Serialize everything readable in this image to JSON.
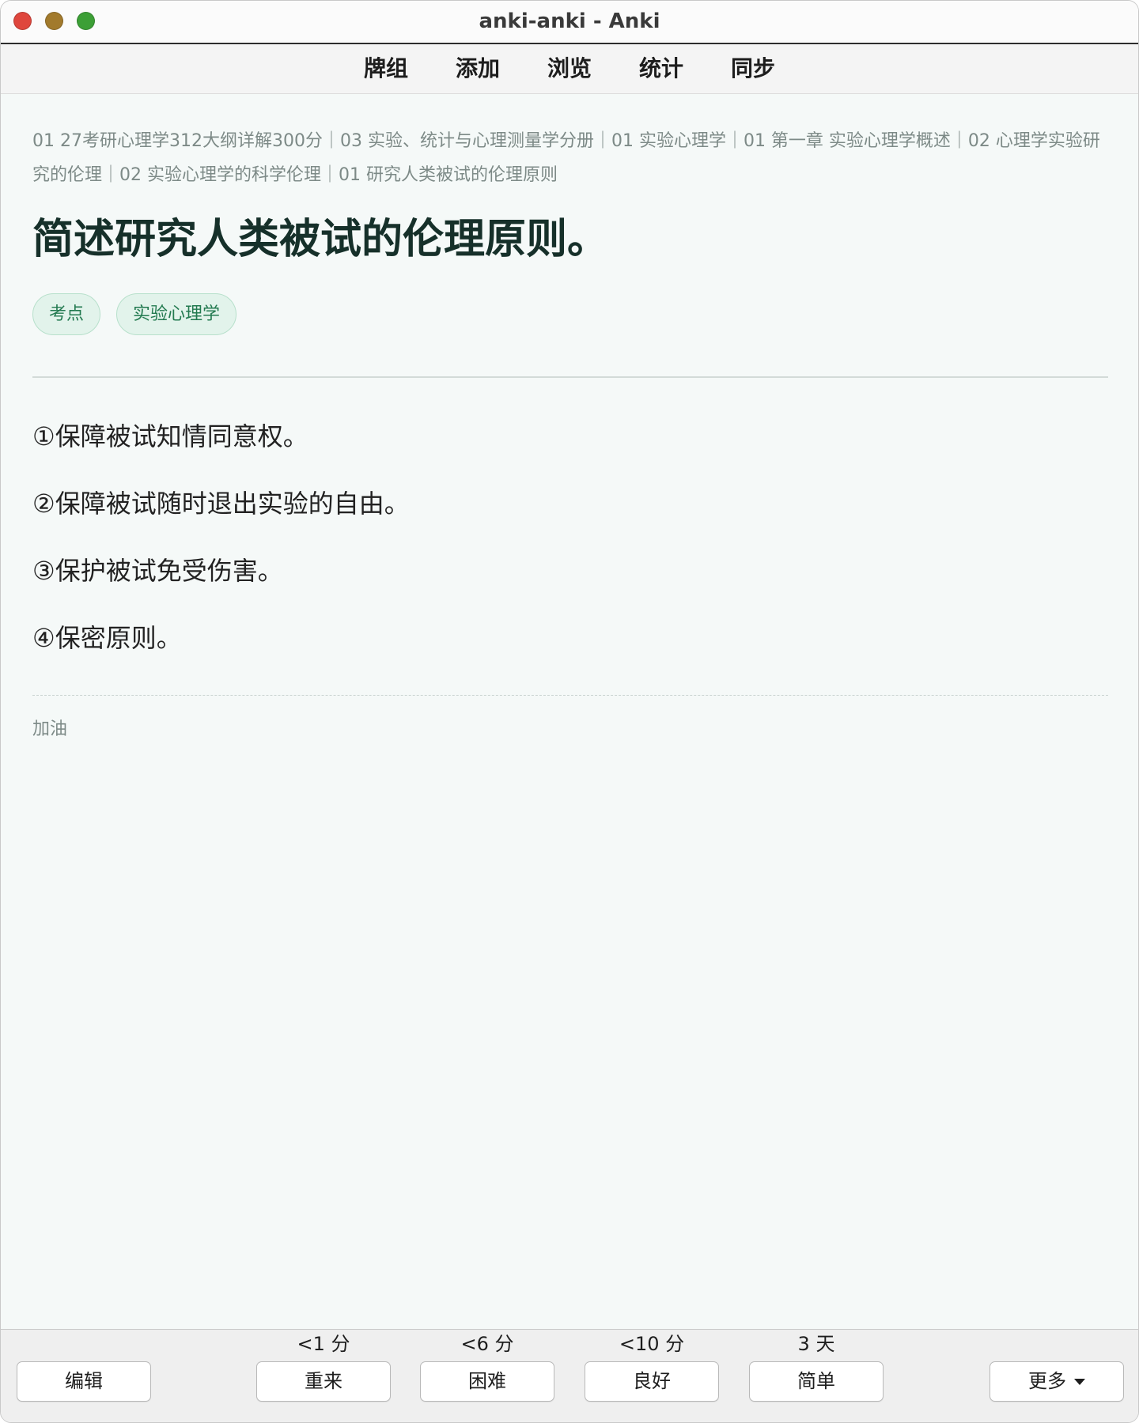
{
  "window": {
    "title": "anki-anki - Anki"
  },
  "toolbar": {
    "items": [
      "牌组",
      "添加",
      "浏览",
      "统计",
      "同步"
    ]
  },
  "card": {
    "breadcrumb": "01 27考研心理学312大纲详解300分｜03 实验、统计与心理测量学分册｜01 实验心理学｜01 第一章 实验心理学概述｜02 心理学实验研究的伦理｜02 实验心理学的科学伦理｜01 研究人类被试的伦理原则",
    "question": "简述研究人类被试的伦理原则。",
    "tags": [
      "考点",
      "实验心理学"
    ],
    "answer": [
      "①保障被试知情同意权。",
      "②保障被试随时退出实验的自由。",
      "③保护被试免受伤害。",
      "④保密原则。"
    ],
    "footer_note": "加油"
  },
  "review_bar": {
    "edit_label": "编辑",
    "answers": [
      {
        "interval": "<1 分",
        "label": "重来"
      },
      {
        "interval": "<6 分",
        "label": "困难"
      },
      {
        "interval": "<10 分",
        "label": "良好"
      },
      {
        "interval": "3 天",
        "label": "简单"
      }
    ],
    "more_label": "更多",
    "more_icon": "caret-down-icon"
  },
  "colors": {
    "content_bg": "#f5f9f8",
    "tag_bg": "#e2f3eb",
    "tag_border": "#b7e0cb",
    "tag_text": "#237a50",
    "heading": "#16302a"
  }
}
